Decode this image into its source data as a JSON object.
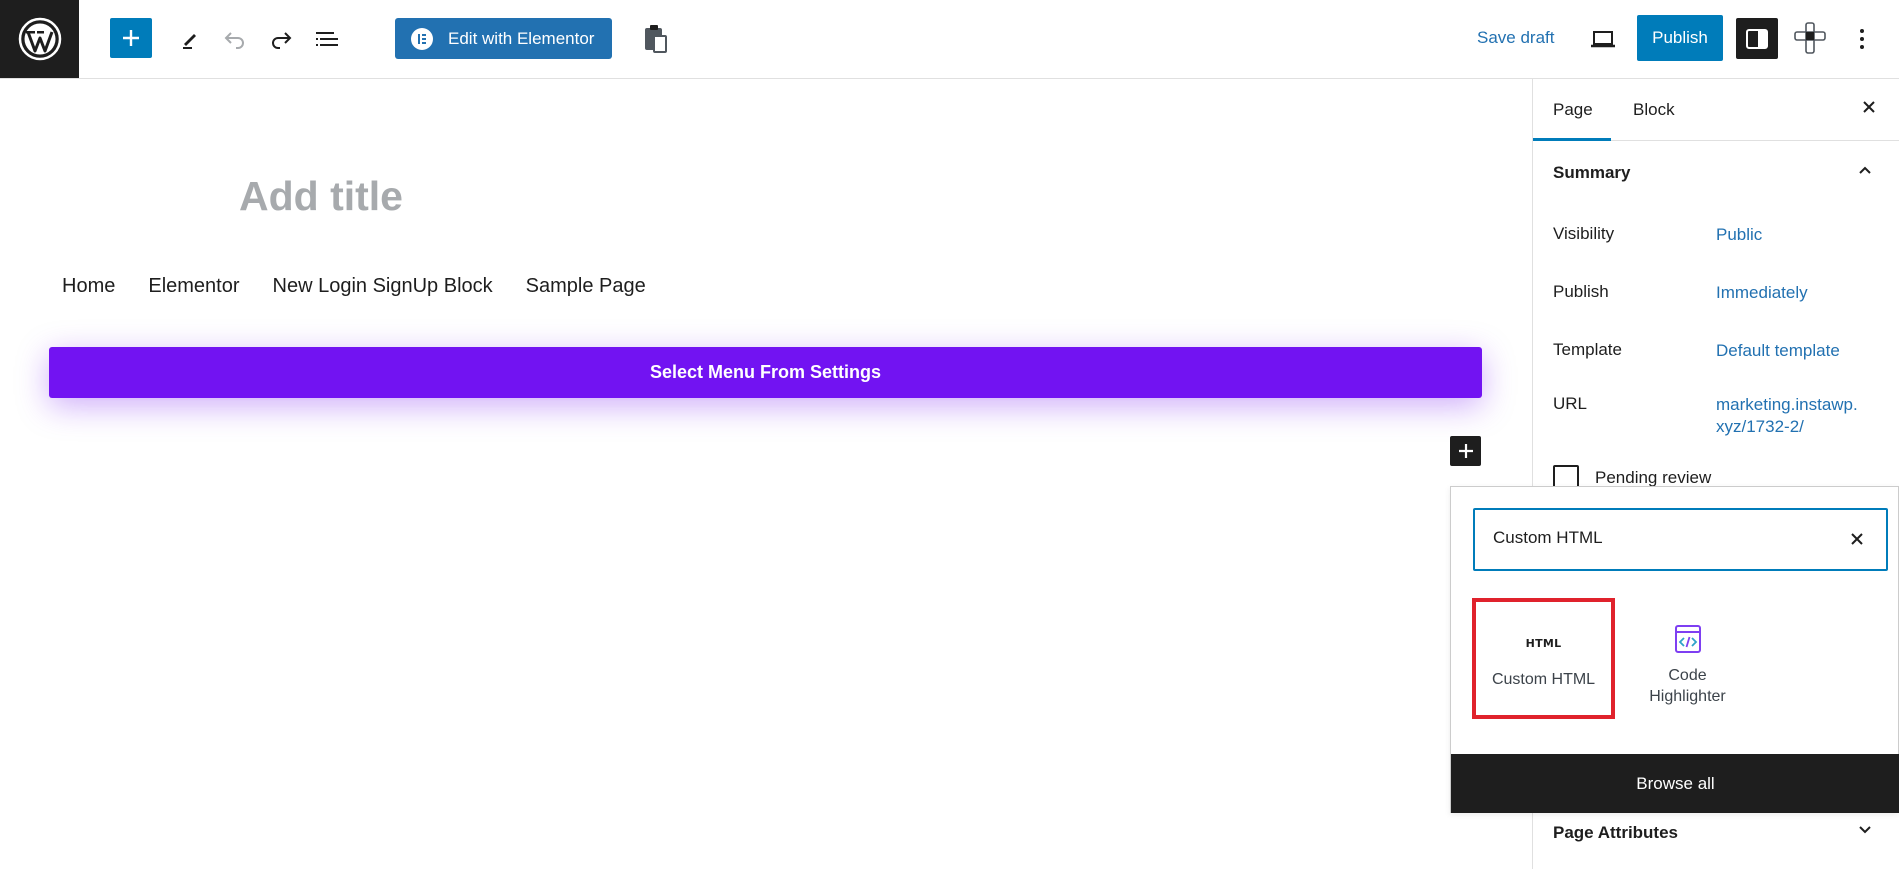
{
  "toolbar": {
    "elementor_label": "Edit with Elementor",
    "save_draft": "Save draft",
    "publish": "Publish"
  },
  "canvas": {
    "title_placeholder": "Add title",
    "nav_items": [
      "Home",
      "Elementor",
      "New Login SignUp Block",
      "Sample Page"
    ],
    "menu_button": "Select Menu From Settings"
  },
  "sidebar": {
    "tabs": [
      "Page",
      "Block"
    ],
    "summary": "Summary",
    "rows": [
      {
        "label": "Visibility",
        "value": "Public"
      },
      {
        "label": "Publish",
        "value": "Immediately"
      },
      {
        "label": "Template",
        "value": "Default template"
      },
      {
        "label": "URL",
        "value": "marketing.instawp.\nxyz/1732-2/"
      }
    ],
    "url_line1": "marketing.instawp.",
    "url_line2": "xyz/1732-2/",
    "pending_review": "Pending review",
    "page_attributes": "Page Attributes"
  },
  "inserter": {
    "search_value": "Custom HTML",
    "blocks": [
      {
        "label": "Custom HTML",
        "icon": "HTML"
      },
      {
        "label": "Code Highlighter",
        "icon": "code-window-icon"
      }
    ],
    "code_line1": "Code",
    "code_line2": "Highlighter",
    "browse_all": "Browse all"
  },
  "colors": {
    "wp_blue": "#007cba",
    "elementor_blue": "#2271b1",
    "menu_purple": "#7213f2",
    "highlight_red": "#e0222c",
    "dark": "#1e1e1e"
  }
}
